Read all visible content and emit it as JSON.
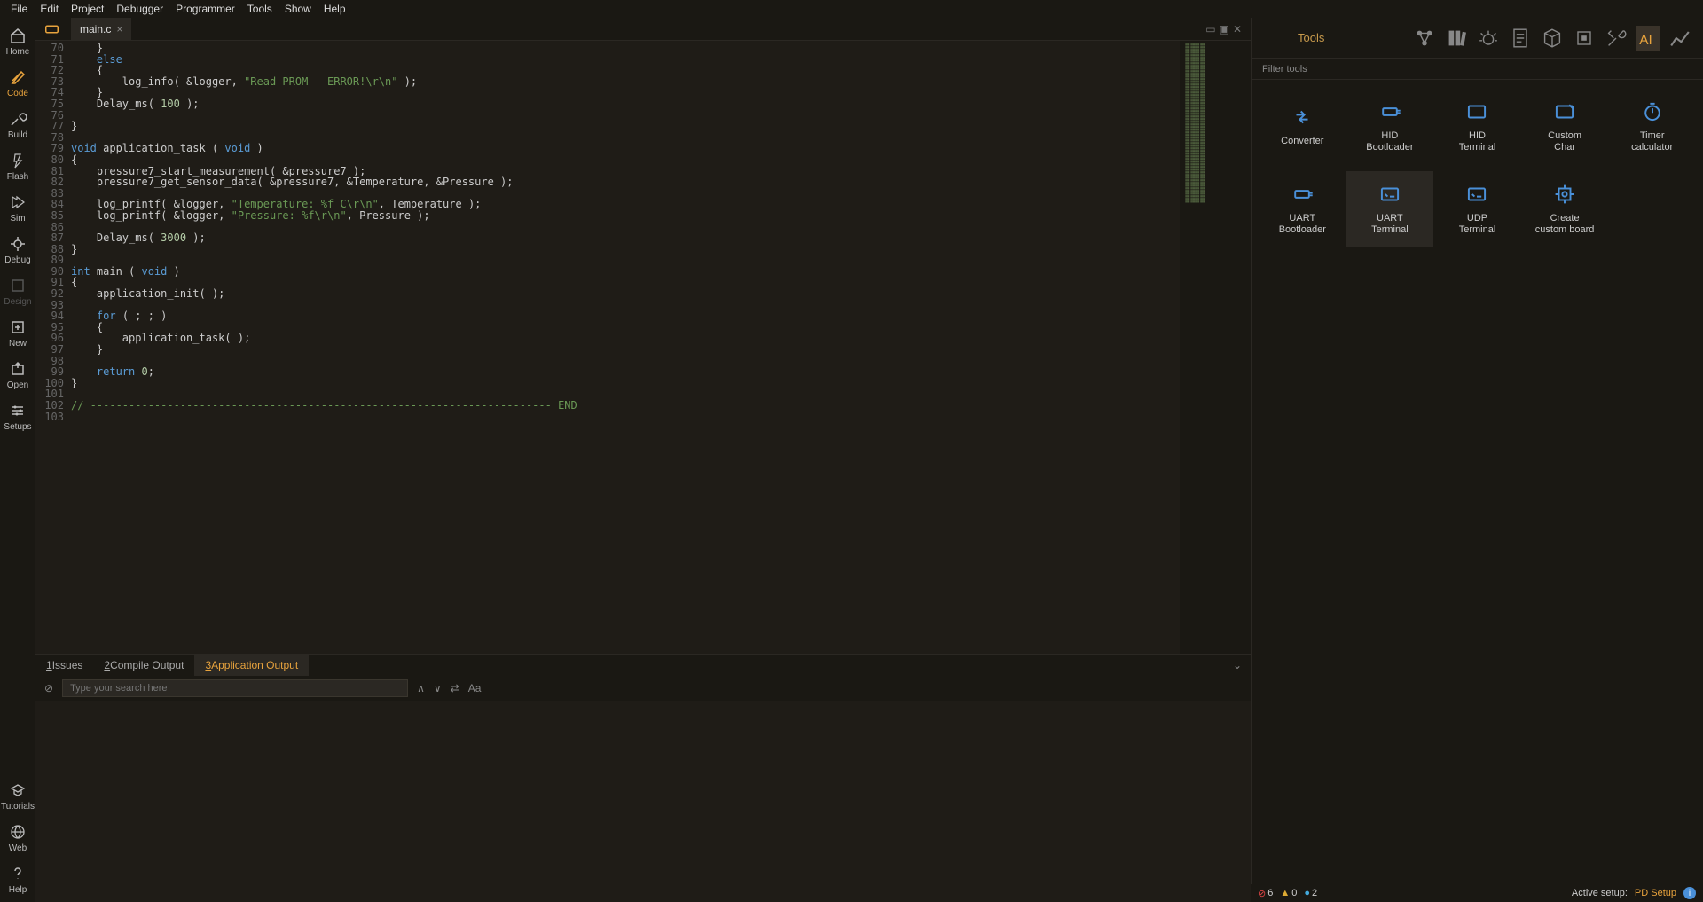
{
  "menu": [
    "File",
    "Edit",
    "Project",
    "Debugger",
    "Programmer",
    "Tools",
    "Show",
    "Help"
  ],
  "sidebar": {
    "items": [
      {
        "label": "Home",
        "icon": "home"
      },
      {
        "label": "Code",
        "icon": "code",
        "active": true
      },
      {
        "label": "Build",
        "icon": "build"
      },
      {
        "label": "Flash",
        "icon": "flash"
      },
      {
        "label": "Sim",
        "icon": "sim"
      },
      {
        "label": "Debug",
        "icon": "debug"
      },
      {
        "label": "Design",
        "icon": "design",
        "disabled": true
      },
      {
        "label": "New",
        "icon": "new"
      },
      {
        "label": "Open",
        "icon": "open"
      },
      {
        "label": "Setups",
        "icon": "setups"
      }
    ],
    "bottom": [
      {
        "label": "Tutorials",
        "icon": "tutorials"
      },
      {
        "label": "Web",
        "icon": "web"
      },
      {
        "label": "Help",
        "icon": "help"
      }
    ]
  },
  "tabs": [
    {
      "label": "main.c"
    }
  ],
  "tab_right_icons": [
    "▭",
    "▣",
    "✕"
  ],
  "code": {
    "startLine": 70,
    "lines": [
      {
        "t": "    }"
      },
      {
        "t": "    ",
        "kw": "else"
      },
      {
        "t": "    {"
      },
      {
        "t": "        log_info( &logger, ",
        "str": "\"Read PROM - ERROR!\\r\\n\"",
        "rest": " );"
      },
      {
        "t": "    }"
      },
      {
        "t": "    Delay_ms( ",
        "num": "100",
        "rest": " );"
      },
      {
        "t": ""
      },
      {
        "t": "}"
      },
      {
        "t": ""
      },
      {
        "kw": "void",
        "t": " application_task ",
        "p": "( ",
        "kw2": "void",
        "p2": " )"
      },
      {
        "t": "{"
      },
      {
        "t": "    pressure7_start_measurement( &pressure7 );"
      },
      {
        "t": "    pressure7_get_sensor_data( &pressure7, &Temperature, &Pressure );"
      },
      {
        "t": ""
      },
      {
        "t": "    log_printf( &logger, ",
        "str": "\"Temperature: %f C\\r\\n\"",
        "rest": ", Temperature );"
      },
      {
        "t": "    log_printf( &logger, ",
        "str": "\"Pressure: %f\\r\\n\"",
        "rest": ", Pressure );"
      },
      {
        "t": ""
      },
      {
        "t": "    Delay_ms( ",
        "num": "3000",
        "rest": " );"
      },
      {
        "t": "}"
      },
      {
        "t": ""
      },
      {
        "kw": "int",
        "t": " main ",
        "p": "( ",
        "kw2": "void",
        "p2": " )"
      },
      {
        "t": "{"
      },
      {
        "t": "    application_init( );"
      },
      {
        "t": ""
      },
      {
        "t": "    ",
        "kw": "for",
        "rest": " ( ; ; )"
      },
      {
        "t": "    {"
      },
      {
        "t": "        application_task( );"
      },
      {
        "t": "    }"
      },
      {
        "t": ""
      },
      {
        "t": "    ",
        "kw": "return",
        "rest": " ",
        "num": "0",
        "rest2": ";"
      },
      {
        "t": "}"
      },
      {
        "t": ""
      },
      {
        "cmt": "// ------------------------------------------------------------------------ END"
      },
      {
        "t": ""
      }
    ]
  },
  "bottom_tabs": [
    {
      "prefix": "1",
      "label": " Issues"
    },
    {
      "prefix": "2",
      "label": " Compile Output"
    },
    {
      "prefix": "3",
      "label": " Application Output",
      "active": true
    }
  ],
  "search_placeholder": "Type your search here",
  "search_icons": [
    "∧",
    "∨",
    "⇄",
    "Aa"
  ],
  "right": {
    "title": "Tools",
    "filter": "Filter tools",
    "header_icons": [
      "share",
      "books",
      "bug",
      "doc",
      "cube",
      "chip",
      "tools",
      "ai",
      "chart"
    ],
    "header_active": 7,
    "tools": [
      {
        "label": "Converter",
        "icon": "conv"
      },
      {
        "label": "HID Bootloader",
        "icon": "hid"
      },
      {
        "label": "HID Terminal",
        "icon": "term"
      },
      {
        "label": "Custom Char",
        "icon": "char"
      },
      {
        "label": "Timer calculator",
        "icon": "timer"
      },
      {
        "label": "UART Bootloader",
        "icon": "uartb"
      },
      {
        "label": "UART Terminal",
        "icon": "uartt",
        "active": true
      },
      {
        "label": "UDP Terminal",
        "icon": "udp"
      },
      {
        "label": "Create custom board",
        "icon": "board"
      }
    ]
  },
  "status": {
    "errors": "6",
    "warnings": "0",
    "info": "2",
    "active_setup_label": "Active setup:",
    "active_setup": "PD Setup"
  }
}
